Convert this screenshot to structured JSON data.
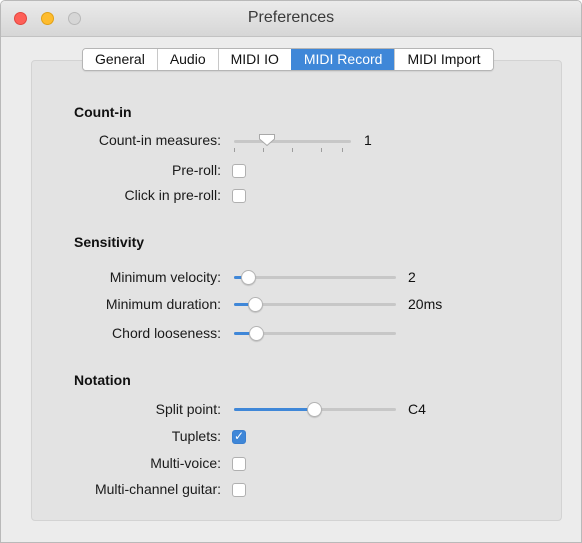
{
  "window": {
    "title": "Preferences"
  },
  "tabs": [
    {
      "label": "General",
      "active": false
    },
    {
      "label": "Audio",
      "active": false
    },
    {
      "label": "MIDI IO",
      "active": false
    },
    {
      "label": "MIDI Record",
      "active": true
    },
    {
      "label": "MIDI Import",
      "active": false
    }
  ],
  "count_in": {
    "title": "Count-in",
    "measures": {
      "label": "Count-in measures:",
      "value": "1"
    },
    "pre_roll": {
      "label": "Pre-roll:",
      "checked": false
    },
    "click_in_pre_roll": {
      "label": "Click in pre-roll:",
      "checked": false
    }
  },
  "sensitivity": {
    "title": "Sensitivity",
    "min_velocity": {
      "label": "Minimum velocity:",
      "value": "2"
    },
    "min_duration": {
      "label": "Minimum duration:",
      "value": "20ms"
    },
    "chord_looseness": {
      "label": "Chord looseness:",
      "value": ""
    }
  },
  "notation": {
    "title": "Notation",
    "split_point": {
      "label": "Split point:",
      "value": "C4"
    },
    "tuplets": {
      "label": "Tuplets:",
      "checked": true
    },
    "multi_voice": {
      "label": "Multi-voice:",
      "checked": false
    },
    "multi_channel_guitar": {
      "label": "Multi-channel guitar:",
      "checked": false
    }
  },
  "colors": {
    "accent": "#3f87d8",
    "close": "#fe5f57",
    "minimize": "#febc2e"
  }
}
